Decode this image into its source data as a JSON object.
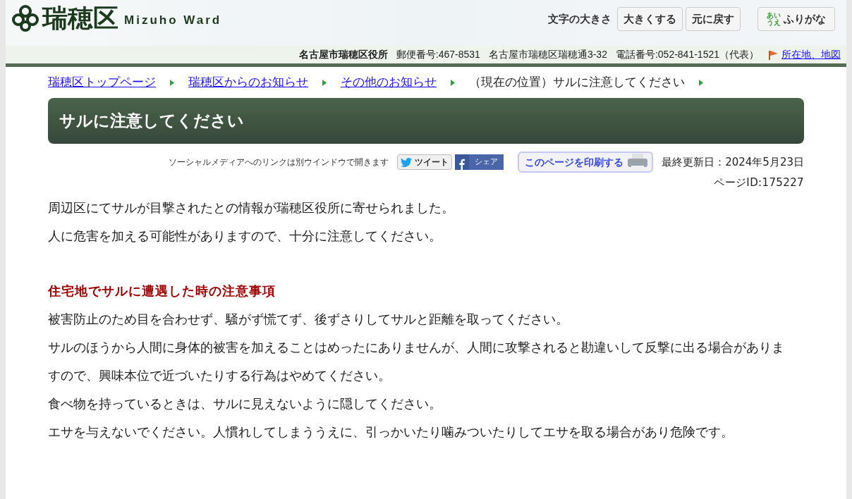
{
  "header": {
    "logo_text": "瑞穂区",
    "logo_subtitle": "Mizuho Ward",
    "font_size_label": "文字の大きさ",
    "font_size_buttons": [
      "大きくする",
      "元に戻す"
    ],
    "furigana_button": {
      "icon_text": "あいうえ",
      "label": "ふりがな"
    }
  },
  "info_bar": {
    "office": "名古屋市瑞穂区役所",
    "postal": "郵便番号:467-8531",
    "address": "名古屋市瑞穂区瑞穂通3-32",
    "phone": "電話番号:052-841-1521（代表）",
    "map_link": "所在地、地図"
  },
  "breadcrumb": [
    {
      "label": "瑞穂区トップページ",
      "link": true
    },
    {
      "label": "瑞穂区からのお知らせ",
      "link": true
    },
    {
      "label": "その他のお知らせ",
      "link": true
    },
    {
      "label": "（現在の位置）サルに注意してください",
      "link": false
    }
  ],
  "title": "サルに注意してください",
  "social": {
    "note": "ソーシャルメディアへのリンクは別ウインドウで開きます",
    "tweet": "ツイート",
    "share": "シェア",
    "print": "このページを印刷する",
    "updated": "最終更新日：2024年5月23日",
    "page_id": "ページID:175227"
  },
  "body": [
    {
      "kind": "text",
      "text": "周辺区にてサルが目撃されたとの情報が瑞穂区役所に寄せられました。"
    },
    {
      "kind": "text",
      "text": "人に危害を加える可能性がありますので、十分に注意してください。"
    },
    {
      "kind": "heading",
      "text": "住宅地でサルに遭遇した時の注意事項"
    },
    {
      "kind": "text",
      "text": "被害防止のため目を合わせず、騒がず慌てず、後ずさりしてサルと距離を取ってください。"
    },
    {
      "kind": "text",
      "text": "サルのほうから人間に身体的被害を加えることはめったにありませんが、人間に攻撃されると勘違いして反撃に出る場合がありますので、興味本位で近づいたりする行為はやめてください。"
    },
    {
      "kind": "text",
      "text": "食べ物を持っているときは、サルに見えないように隠してください。"
    },
    {
      "kind": "text",
      "text": "エサを与えないでください。人慣れしてしまううえに、引っかいたり噛みついたりしてエサを取る場合があり危険です。"
    }
  ]
}
